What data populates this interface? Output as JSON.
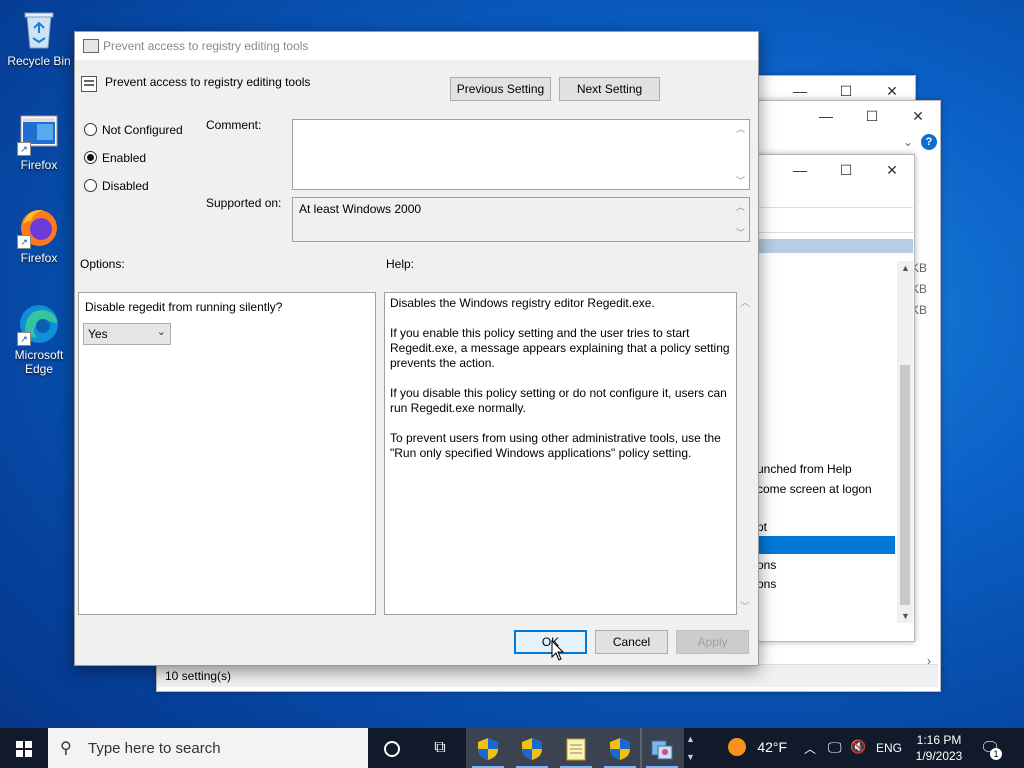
{
  "desktop": {
    "icons": [
      {
        "label": "Recycle Bin",
        "icon": "recycle-bin-icon"
      },
      {
        "label": "Firefox",
        "icon": "firefox-shortcut-icon"
      },
      {
        "label": "Firefox",
        "icon": "firefox-icon"
      },
      {
        "label": "Microsoft Edge",
        "icon": "edge-icon"
      }
    ]
  },
  "background_window": {
    "list_fragments": [
      "unched from Help",
      "come screen at logon",
      "pt",
      "ons",
      "ons"
    ],
    "side_fragments": [
      "KB",
      "KB",
      "KB"
    ],
    "status": "10 setting(s)"
  },
  "dialog": {
    "window_title": "Prevent access to registry editing tools",
    "header_title": "Prevent access to registry editing tools",
    "previous_label": "Previous Setting",
    "next_label": "Next Setting",
    "radios": [
      {
        "label": "Not Configured",
        "checked": false
      },
      {
        "label": "Enabled",
        "checked": true
      },
      {
        "label": "Disabled",
        "checked": false
      }
    ],
    "comment_label": "Comment:",
    "comment_value": "",
    "supported_label": "Supported on:",
    "supported_value": "At least Windows 2000",
    "options_label": "Options:",
    "help_label": "Help:",
    "option_question": "Disable regedit from running silently?",
    "option_select_value": "Yes",
    "help_paragraphs": [
      "Disables the Windows registry editor Regedit.exe.",
      "If you enable this policy setting and the user tries to start Regedit.exe, a message appears explaining that a policy setting prevents the action.",
      "If you disable this policy setting or do not configure it, users can run Regedit.exe normally.",
      "To prevent users from using other administrative tools, use the \"Run only specified Windows applications\" policy setting."
    ],
    "ok_label": "OK",
    "cancel_label": "Cancel",
    "apply_label": "Apply"
  },
  "taskbar": {
    "search_placeholder": "Type here to search",
    "weather_temp": "42°F",
    "language": "ENG",
    "time": "1:16 PM",
    "date": "1/9/2023",
    "notification_count": "1"
  },
  "colors": {
    "accent": "#0078d7",
    "selection": "#0078d7",
    "taskbar": "#101a2a"
  }
}
